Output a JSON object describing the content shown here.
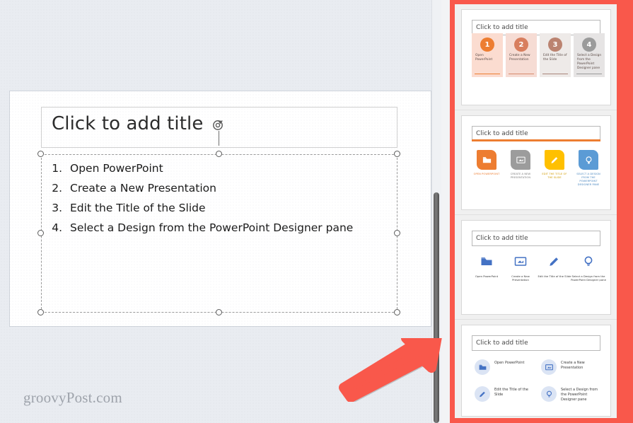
{
  "app": {
    "watermark": "groovyPost.com"
  },
  "slide": {
    "title_placeholder": "Click to add title",
    "body_items": [
      "Open PowerPoint",
      "Create a New Presentation",
      "Edit the Title of the Slide",
      "Select a Design from the PowerPoint Designer pane"
    ],
    "rotate_handle_name": "rotate-handle"
  },
  "designer": {
    "highlight_color": "#f9584b",
    "thumbnails": [
      {
        "title_placeholder": "Click to add title",
        "style": "numbered-cards",
        "cards": [
          {
            "number": "1",
            "caption": "Open PowerPoint",
            "bg": "#fbdcd0",
            "circle": "#ed7d31",
            "rule": "#ed7d31"
          },
          {
            "number": "2",
            "caption": "Create a New Presentation",
            "bg": "#f6dcd4",
            "circle": "#d87e5e",
            "rule": "#d68a6c"
          },
          {
            "number": "3",
            "caption": "Edit the Title of the Slide",
            "bg": "#eeeae8",
            "circle": "#bb8370",
            "rule": "#a8857a"
          },
          {
            "number": "4",
            "caption": "Select a Design from the PowerPoint Designer pane",
            "bg": "#e6e4e4",
            "circle": "#9b9b9b",
            "rule": "#9b9b9b"
          }
        ]
      },
      {
        "title_placeholder": "Click to add title",
        "style": "color-tiles",
        "accent_color": "#ed7d31",
        "tiles": [
          {
            "icon": "folder-icon",
            "caption": "Open PowerPoint",
            "bg": "#ed7d31",
            "text": "#ed7d31"
          },
          {
            "icon": "presentation-icon",
            "caption": "Create a New Presentation",
            "bg": "#9c9c9c",
            "text": "#7a7a7a"
          },
          {
            "icon": "pencil-icon",
            "caption": "Edit the Title of the Slide",
            "bg": "#ffc000",
            "text": "#d19b00"
          },
          {
            "icon": "lightbulb-icon",
            "caption": "Select a Design from the PowerPoint Designer pane",
            "bg": "#5b9bd5",
            "text": "#4a87c0"
          }
        ]
      },
      {
        "title_placeholder": "Click to add title",
        "style": "blue-icons",
        "icon_color": "#4472c4",
        "icons": [
          {
            "icon": "folder-icon",
            "caption": "Open PowerPoint"
          },
          {
            "icon": "presentation-icon",
            "caption": "Create a New Presentation"
          },
          {
            "icon": "pencil-icon",
            "caption": "Edit the Title of the Slide"
          },
          {
            "icon": "lightbulb-icon",
            "caption": "Select a Design from the PowerPoint Designer pane"
          }
        ]
      },
      {
        "title_placeholder": "Click to add title",
        "style": "circle-grid",
        "icon_color": "#4472c4",
        "items": [
          {
            "icon": "folder-icon",
            "caption": "Open PowerPoint"
          },
          {
            "icon": "presentation-icon",
            "caption": "Create a New Presentation"
          },
          {
            "icon": "pencil-icon",
            "caption": "Edit the Title of the Slide"
          },
          {
            "icon": "lightbulb-icon",
            "caption": "Select a Design from the PowerPoint Designer pane"
          }
        ]
      }
    ]
  },
  "annotation": {
    "arrow_color": "#f9584b",
    "arrow_name": "callout-arrow-to-designer-pane"
  }
}
